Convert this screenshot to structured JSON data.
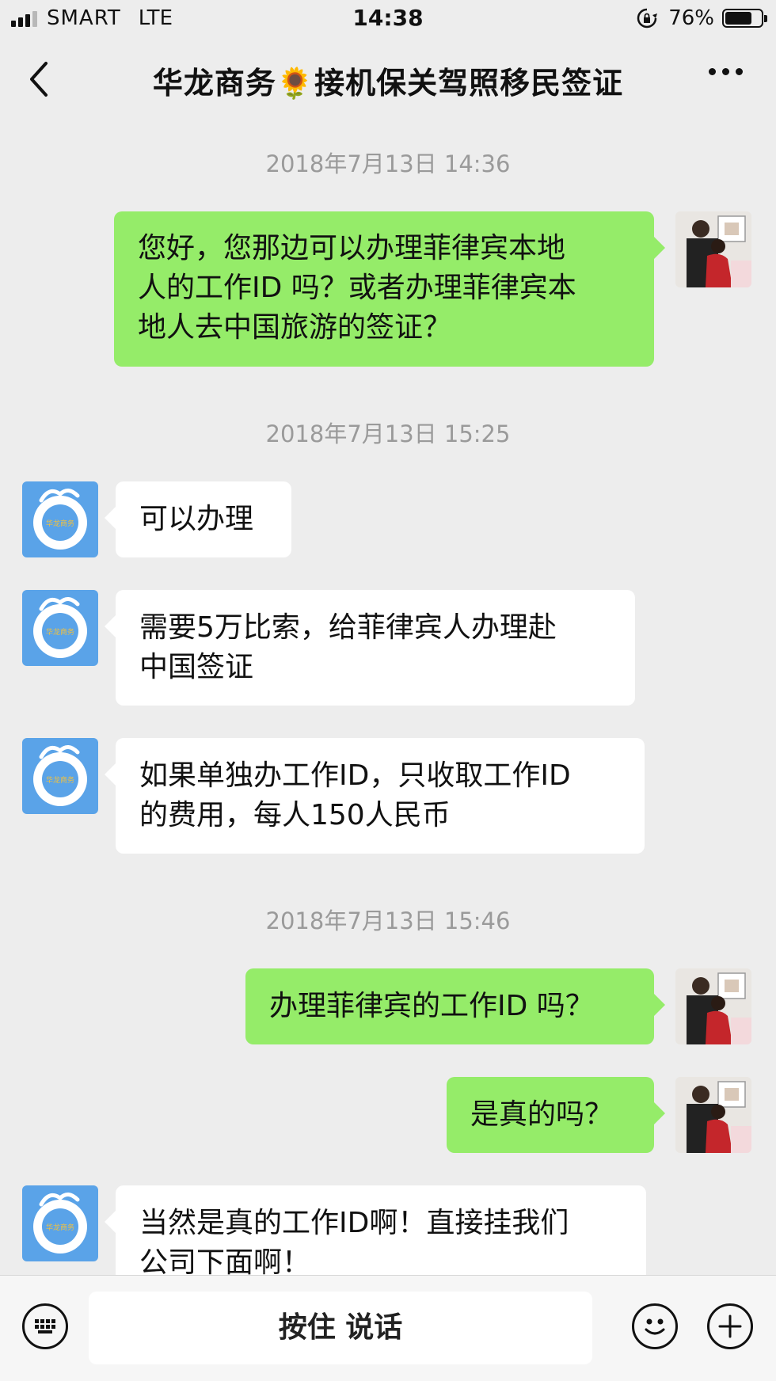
{
  "status_bar": {
    "carrier": "SMART",
    "network": "LTE",
    "time": "14:38",
    "battery": "76%",
    "battery_level": 0.76
  },
  "nav": {
    "title": "华龙商务🌻接机保关驾照移民签证"
  },
  "messages": {
    "ts1": "2018年7月13日 14:36",
    "m1_lines": [
      "您好，您那边可以办理菲律宾本地",
      "人的工作ID 吗？或者办理菲律宾本",
      "地人去中国旅游的签证？"
    ],
    "ts2": "2018年7月13日 15:25",
    "m2": "可以办理",
    "m3_lines": [
      "需要5万比索，给菲律宾人办理赴",
      "中国签证"
    ],
    "m4_lines": [
      "如果单独办工作ID，只收取工作ID",
      "的费用，每人150人民币"
    ],
    "ts3": "2018年7月13日 15:46",
    "m5": "办理菲律宾的工作ID 吗？",
    "m6": "是真的吗？",
    "m7_lines": [
      "当然是真的工作ID啊！直接挂我们",
      "公司下面啊！"
    ],
    "logo_text": "华龙商务"
  },
  "input_bar": {
    "hold_label": "按住 说话"
  },
  "icons": {
    "back": "chevron-left-icon",
    "more": "more-dots-icon",
    "keyboard": "keyboard-icon",
    "emoji": "emoji-icon",
    "plus": "plus-icon",
    "rotation_lock": "rotation-lock-icon"
  },
  "colors": {
    "background": "#ededed",
    "my_bubble": "#95ec69",
    "their_bubble": "#ffffff",
    "timestamp": "#9a9a9a",
    "logo_blue": "#5aa3e8"
  }
}
